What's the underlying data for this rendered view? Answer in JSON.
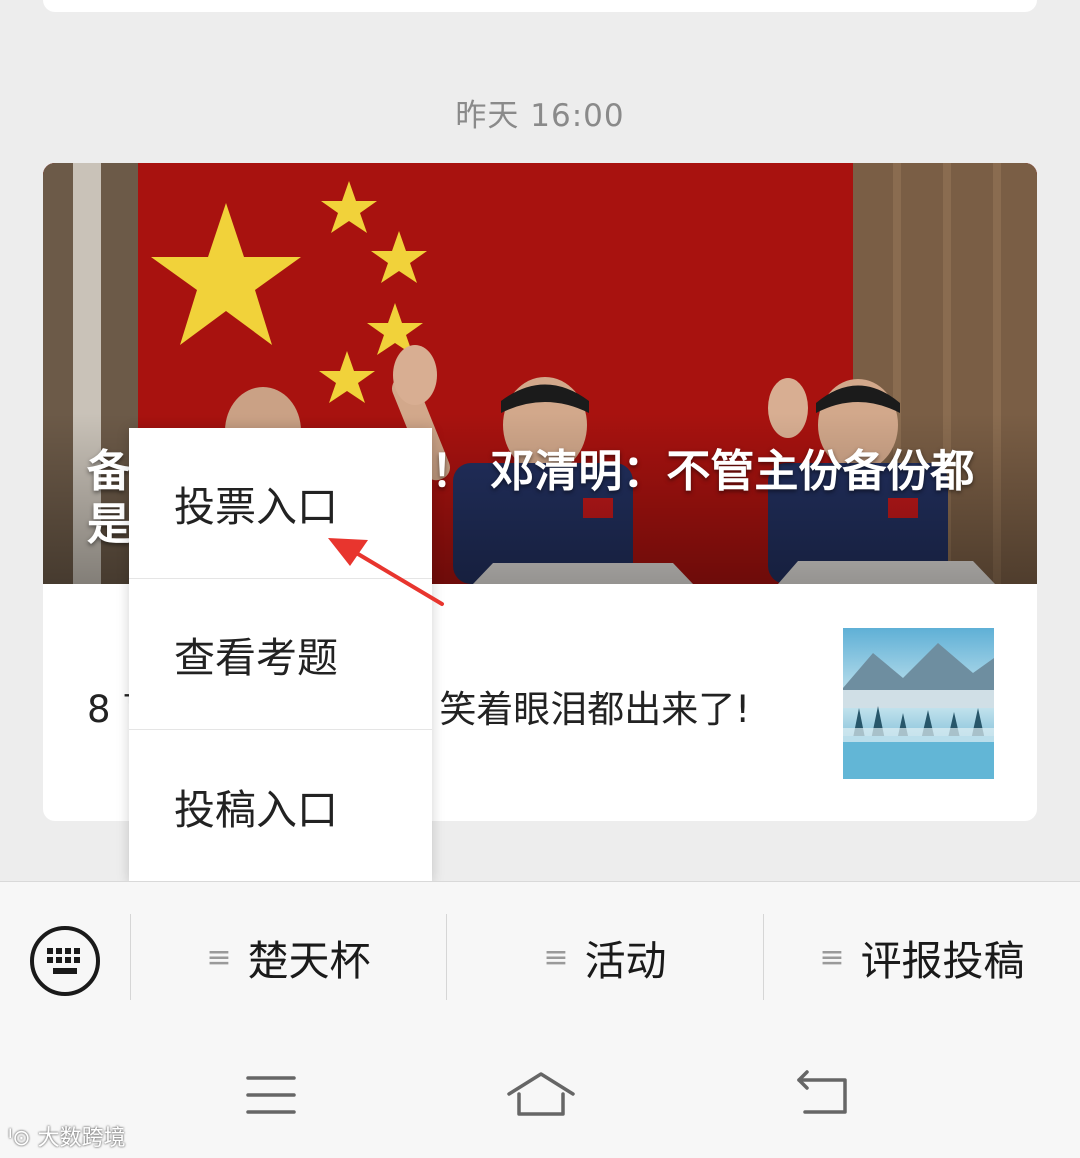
{
  "chat": {
    "timestamp": "昨天 16:00",
    "article": {
      "cover_title_left": "备",
      "cover_title_left2": "是",
      "cover_title_right": "！ 邓清明：不管主份备份都",
      "sub_title_left": "8 盲",
      "sub_title_right": "笑着眼泪都出来了!"
    }
  },
  "popup_menu": {
    "items": [
      "投票入口",
      "查看考题",
      "投稿入口"
    ]
  },
  "bottom_menu": {
    "items": [
      "楚天杯",
      "活动",
      "评报投稿"
    ],
    "lines_glyph": "≡"
  },
  "watermark": "大数跨境",
  "colors": {
    "accent_arrow": "#e8352e",
    "flag_red": "#a8120f",
    "star_yellow": "#f1d23a"
  }
}
